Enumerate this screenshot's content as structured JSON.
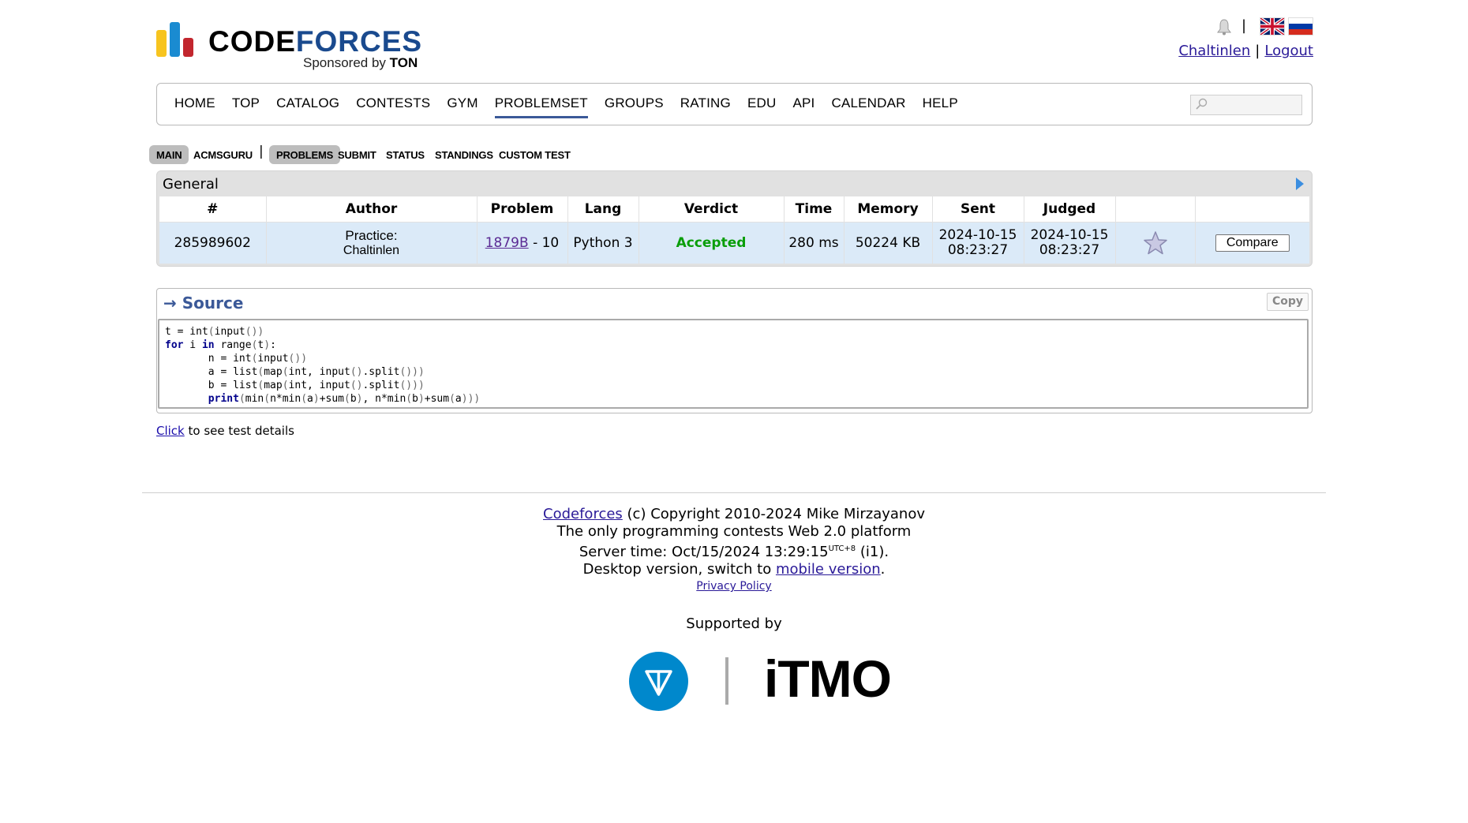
{
  "header": {
    "logo_code": "CODE",
    "logo_forces": "FORCES",
    "sponsor_prefix": "Sponsored by",
    "sponsor_name": "TON",
    "user_link": "Chaltinlen",
    "logout_link": "Logout",
    "separator": "|",
    "bell_icon": "notification-bell-icon",
    "flags": [
      "uk-flag-icon",
      "ru-flag-icon"
    ]
  },
  "main_menu": {
    "items": [
      "HOME",
      "TOP",
      "CATALOG",
      "CONTESTS",
      "GYM",
      "PROBLEMSET",
      "GROUPS",
      "RATING",
      "EDU",
      "API",
      "CALENDAR",
      "HELP"
    ],
    "active": "PROBLEMSET",
    "search_placeholder": ""
  },
  "sub_menu": {
    "items": [
      "MAIN",
      "ACMSGURU",
      "PROBLEMS",
      "SUBMIT",
      "STATUS",
      "STANDINGS",
      "CUSTOM TEST"
    ],
    "separator": "|"
  },
  "status_table": {
    "title": "General",
    "headers": [
      "#",
      "Author",
      "Problem",
      "Lang",
      "Verdict",
      "Time",
      "Memory",
      "Sent",
      "Judged",
      "",
      ""
    ],
    "row": {
      "id": "285989602",
      "author_line1": "Practice:",
      "author_line2": "Chaltinlen",
      "problem_link": "1879B",
      "problem_suffix": " - 10",
      "lang": "Python 3",
      "verdict": "Accepted",
      "time": "280 ms",
      "memory": "50224 KB",
      "sent_date": "2024-10-15",
      "sent_time": "08:23:27",
      "judged_date": "2024-10-15",
      "judged_time": "08:23:27",
      "compare_label": "Compare"
    },
    "colors": {
      "accepted": "#0a9e0a",
      "row_bg": "#dbeaf8",
      "header_bg": "#e1e1e1"
    }
  },
  "source": {
    "heading": "→ Source",
    "copy_label": "Copy",
    "code_lines": [
      "t = int(input())",
      "for i in range(t):",
      "\tn = int(input())",
      "\ta = list(map(int, input().split()))",
      "\tb = list(map(int, input().split()))",
      "\tprint(min(n*min(a)+sum(b), n*min(b)+sum(a)))"
    ]
  },
  "click_details": {
    "link": "Click",
    "text": " to see test details"
  },
  "footer": {
    "codeforces_link": "Codeforces",
    "copyright": " (c) Copyright 2010-2024 Mike Mirzayanov",
    "tagline": "The only programming contests Web 2.0 platform",
    "server_time_prefix": "Server time: Oct/15/2024 13:29:15",
    "server_tz": "UTC+8",
    "server_suffix": " (i1).",
    "desktop_prefix": "Desktop version, switch to ",
    "mobile_link": "mobile version",
    "desktop_suffix": ".",
    "privacy_link": "Privacy Policy",
    "supported_by": "Supported by",
    "itmo_logo": "iTMO",
    "ton_logo": "ton-logo-icon"
  }
}
